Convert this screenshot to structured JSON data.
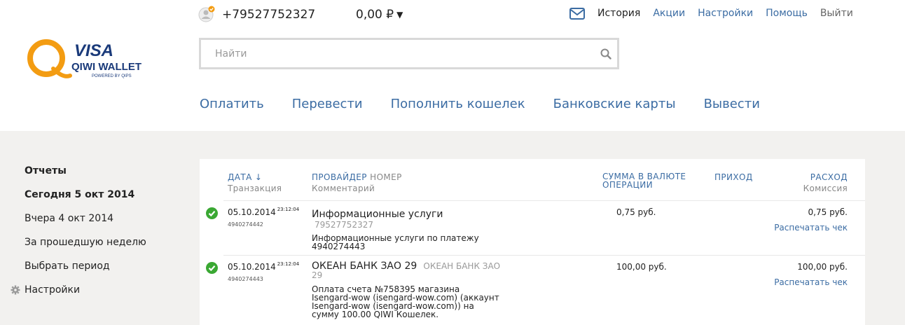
{
  "header": {
    "logo": {
      "brand_top": "VISA",
      "brand_main": "QIWI WALLET",
      "brand_sub": "POWERED BY QIPS"
    },
    "phone": "+79527752327",
    "balance": "0,00 ₽",
    "links": [
      {
        "label": "История",
        "active": true
      },
      {
        "label": "Акции"
      },
      {
        "label": "Настройки"
      },
      {
        "label": "Помощь"
      },
      {
        "label": "Выйти"
      }
    ]
  },
  "search": {
    "placeholder": "Найти"
  },
  "nav": [
    "Оплатить",
    "Перевести",
    "Пополнить кошелек",
    "Банковские карты",
    "Вывести"
  ],
  "sidebar": {
    "title": "Отчеты",
    "items": [
      "Сегодня 5 окт 2014",
      "Вчера 4 окт 2014",
      "За прошедшую неделю",
      "Выбрать период"
    ],
    "settings": "Настройки"
  },
  "table": {
    "headers": {
      "date": "Дата ↓",
      "date_sub": "Транзакция",
      "provider": "Провайдер",
      "number": "Номер",
      "provider_sub": "Комментарий",
      "amount_line1": "Сумма в валюте",
      "amount_line2": "операции",
      "income": "Приход",
      "expense": "Расход",
      "expense_sub": "Комиссия"
    },
    "rows": [
      {
        "date": "05.10.2014",
        "time": "23:12:04",
        "txid": "4940274442",
        "provider": "Информационные услуги",
        "number": "79527752327",
        "comment": "Информационные услуги по платежу 4940274443",
        "amount": "0,75 руб.",
        "expense": "0,75 руб.",
        "print": "Распечатать чек"
      },
      {
        "date": "05.10.2014",
        "time": "23:12:04",
        "txid": "4940274443",
        "provider": "ОКЕАН БАНК ЗАО 29",
        "number": "ОКЕАН БАНК ЗАО 29",
        "comment": "Оплата счета №758395 магазина Isengard-wow (isengard-wow.com) (аккаунт Isengard-wow (isengard-wow.com)) на сумму 100.00 QIWI Кошелек.",
        "amount": "100,00 руб.",
        "expense": "100,00 руб.",
        "print": "Распечатать чек"
      }
    ]
  },
  "colors": {
    "link": "#3b6ca3",
    "accent_orange": "#f39c12",
    "success": "#3aa833",
    "background": "#f2f1ef"
  }
}
